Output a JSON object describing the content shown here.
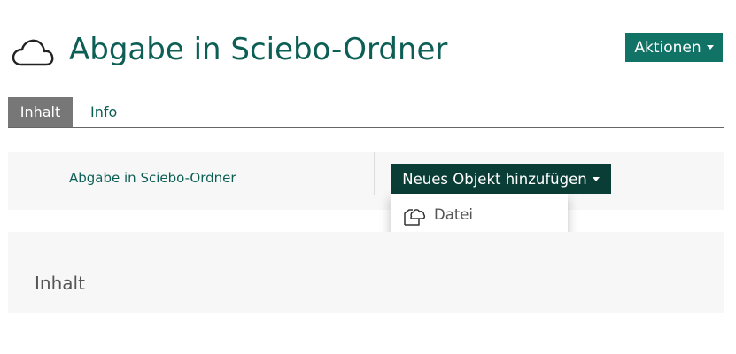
{
  "header": {
    "icon": "cloud-icon",
    "title": "Abgabe in Sciebo-Ordner",
    "actions_label": "Aktionen"
  },
  "tabs": [
    {
      "label": "Inhalt",
      "active": true
    },
    {
      "label": "Info",
      "active": false
    }
  ],
  "breadcrumb": {
    "label": "Abgabe in Sciebo-Ordner"
  },
  "add_menu": {
    "button_label": "Neues Objekt hinzufügen",
    "items": [
      {
        "label": "Datei",
        "icon": "cloud-file-icon"
      }
    ]
  },
  "content_panel": {
    "title": "Inhalt"
  },
  "colors": {
    "accent": "#107366",
    "title_text": "#0d5f55",
    "dark_button": "#0b3d37",
    "active_tab": "#777777",
    "panel_bg": "#f7f7f7"
  }
}
